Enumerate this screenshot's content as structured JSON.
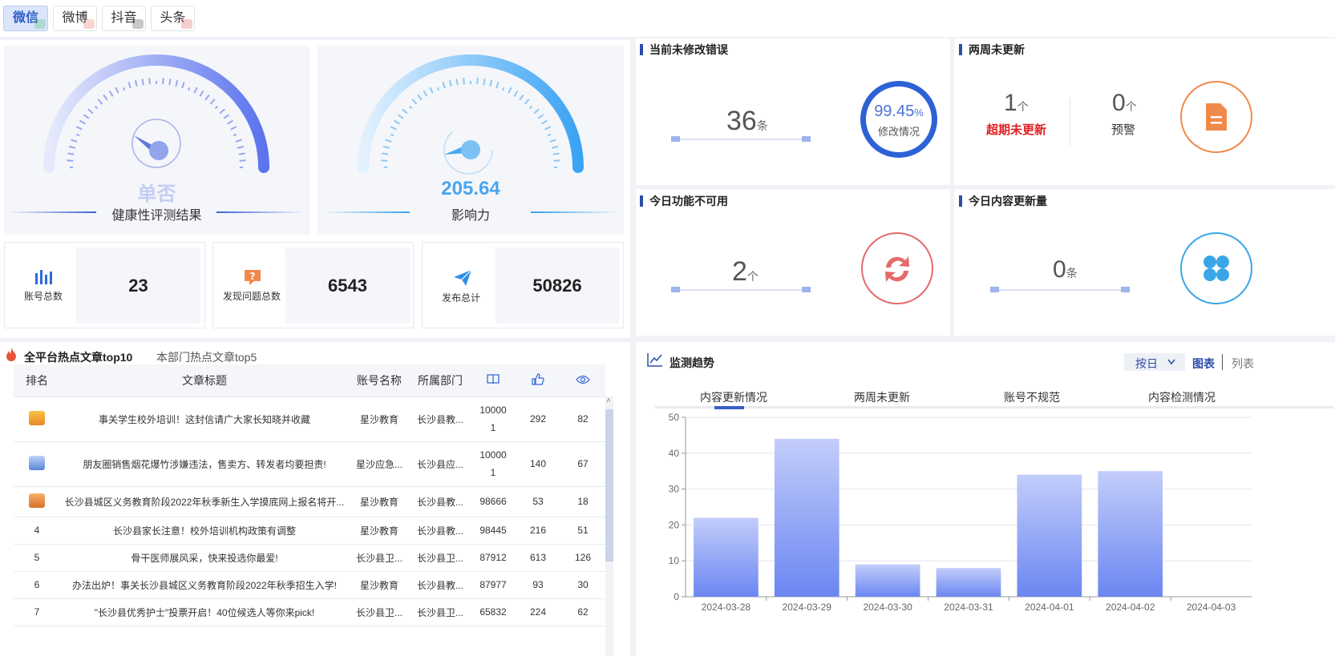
{
  "platform_tabs": [
    {
      "label": "微信",
      "active": true
    },
    {
      "label": "微博",
      "active": false
    },
    {
      "label": "抖音",
      "active": false
    },
    {
      "label": "头条",
      "active": false
    }
  ],
  "health": {
    "value": "单否",
    "label": "健康性评测结果",
    "gauge_level": 0.1
  },
  "influence": {
    "value": "205.64",
    "label": "影响力",
    "gauge_level": 0.7
  },
  "stats": [
    {
      "label": "账号总数",
      "value": "23",
      "icon": "bar-chart-icon"
    },
    {
      "label": "发现问题总数",
      "value": "6543",
      "icon": "question-icon"
    },
    {
      "label": "发布总计",
      "value": "50826",
      "icon": "paper-plane-icon"
    }
  ],
  "errors_panel": {
    "title": "当前未修改错误",
    "count": "36",
    "unit": "条",
    "percent": "99.45",
    "percent_sign": "%",
    "percent_label": "修改情况",
    "percent_value": 99.45
  },
  "stale_panel": {
    "title": "两周未更新",
    "overdue_count": "1",
    "overdue_unit": "个",
    "overdue_label": "超期未更新",
    "warn_count": "0",
    "warn_unit": "个",
    "warn_label": "预警"
  },
  "unavailable_panel": {
    "title": "今日功能不可用",
    "count": "2",
    "unit": "个"
  },
  "today_panel": {
    "title": "今日内容更新量",
    "count": "0",
    "unit": "条"
  },
  "hot": {
    "tab_active": "全平台热点文章top10",
    "tab_other": "本部门热点文章top5",
    "headers": {
      "rank": "排名",
      "title": "文章标题",
      "account": "账号名称",
      "dept": "所属部门"
    },
    "rows": [
      {
        "rank": "1",
        "title": "事关学生校外培训！这封信请广大家长知晓并收藏",
        "account": "星沙教育",
        "dept": "长沙县教...",
        "reads": "100001",
        "likes": "292",
        "views": "82"
      },
      {
        "rank": "2",
        "title": "朋友圈销售烟花爆竹涉嫌违法，售卖方、转发者均要担责!",
        "account": "星沙应急...",
        "dept": "长沙县应...",
        "reads": "100001",
        "likes": "140",
        "views": "67"
      },
      {
        "rank": "3",
        "title": "长沙县城区义务教育阶段2022年秋季新生入学摸底网上报名将开...",
        "account": "星沙教育",
        "dept": "长沙县教...",
        "reads": "98666",
        "likes": "53",
        "views": "18"
      },
      {
        "rank": "4",
        "title": "长沙县家长注意！校外培训机构政策有调整",
        "account": "星沙教育",
        "dept": "长沙县教...",
        "reads": "98445",
        "likes": "216",
        "views": "51"
      },
      {
        "rank": "5",
        "title": "骨干医师展风采，快来投选你最爱!",
        "account": "长沙县卫...",
        "dept": "长沙县卫...",
        "reads": "87912",
        "likes": "613",
        "views": "126"
      },
      {
        "rank": "6",
        "title": "办法出炉！事关长沙县城区义务教育阶段2022年秋季招生入学!",
        "account": "星沙教育",
        "dept": "长沙县教...",
        "reads": "87977",
        "likes": "93",
        "views": "30"
      },
      {
        "rank": "7",
        "title": "\"长沙县优秀护士\"投票开启！40位候选人等你来pick!",
        "account": "长沙县卫...",
        "dept": "长沙县卫...",
        "reads": "65832",
        "likes": "224",
        "views": "62"
      }
    ]
  },
  "trend": {
    "title": "监测趋势",
    "period": "按日",
    "view_chart": "图表",
    "view_list": "列表",
    "tabs": [
      "内容更新情况",
      "两周未更新",
      "账号不规范",
      "内容检测情况"
    ]
  },
  "chart_data": {
    "type": "bar",
    "categories": [
      "2024-03-28",
      "2024-03-29",
      "2024-03-30",
      "2024-03-31",
      "2024-04-01",
      "2024-04-02",
      "2024-04-03"
    ],
    "values": [
      22,
      44,
      9,
      8,
      34,
      35,
      0
    ],
    "ylim": [
      0,
      50
    ],
    "yticks": [
      0,
      10,
      20,
      30,
      40,
      50
    ],
    "grid": true,
    "bar_color_top": "#c3cdfa",
    "bar_color_bottom": "#6b86f2"
  },
  "colors": {
    "accent": "#2d4ea8",
    "red": "#e02020",
    "orange": "#f08a4b",
    "refresh": "#e56a6a",
    "blue": "#3aa6e8"
  }
}
